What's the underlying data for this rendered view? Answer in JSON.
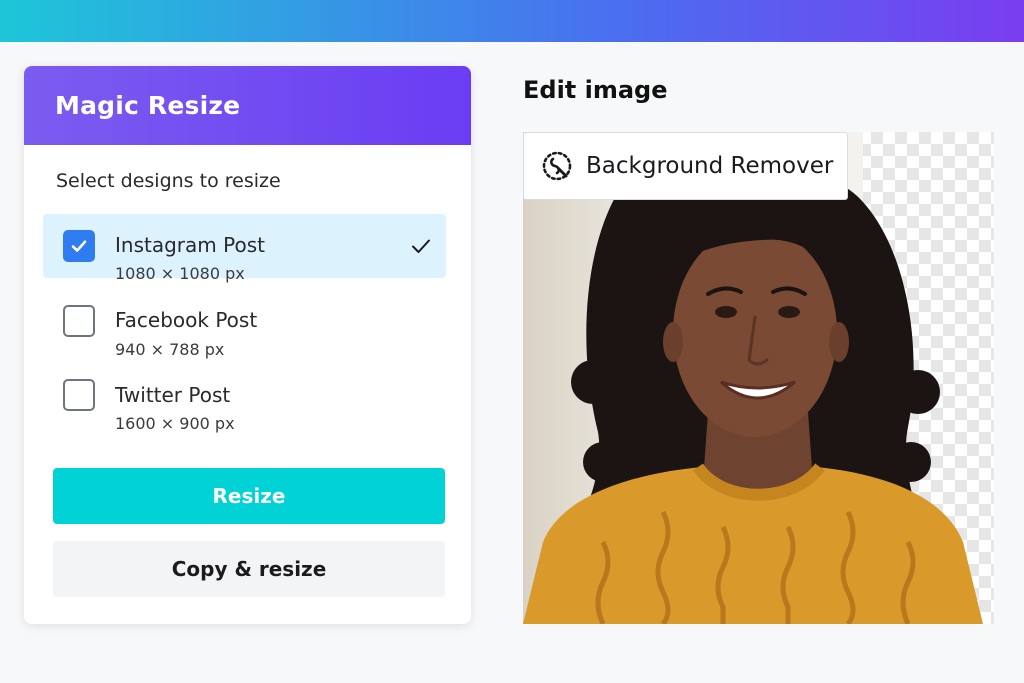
{
  "panel": {
    "title": "Magic Resize",
    "section_label": "Select designs to resize",
    "options": [
      {
        "name": "Instagram Post",
        "size": "1080 × 1080 px",
        "checked": true
      },
      {
        "name": "Facebook Post",
        "size": "940 × 788 px",
        "checked": false
      },
      {
        "name": "Twitter Post",
        "size": "1600 × 900 px",
        "checked": false
      }
    ],
    "resize_label": "Resize",
    "copy_resize_label": "Copy & resize"
  },
  "editor": {
    "title": "Edit image",
    "tool_label": "Background Remover",
    "tool_icon": "background-remover-icon"
  },
  "colors": {
    "banner_start": "#1ec6d8",
    "banner_end": "#7a3df0",
    "header_purple": "#6a3df2",
    "resize_button": "#00d2d6",
    "checkbox_checked": "#2f7cf0",
    "selected_row": "#dcf2fd"
  }
}
